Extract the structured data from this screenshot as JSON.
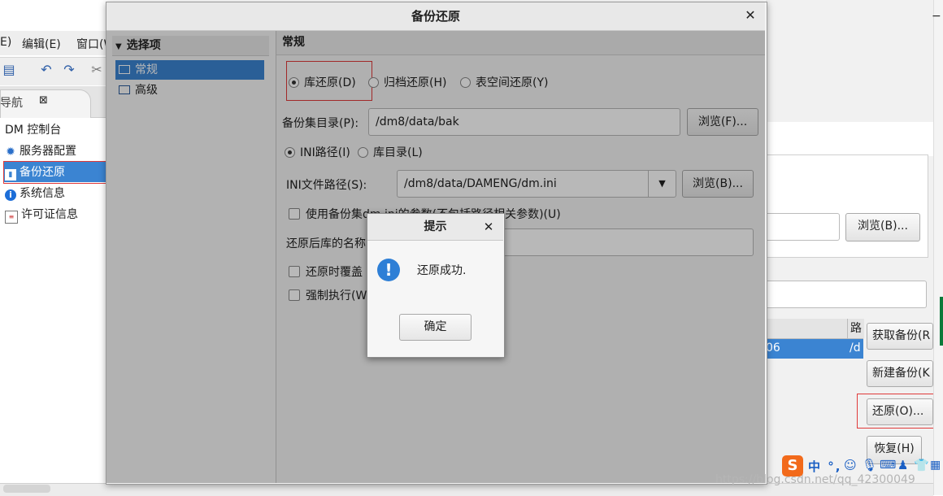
{
  "background": {
    "menu": [
      "E)",
      "编辑(E)",
      "窗口(W)"
    ],
    "tab_label": "导航",
    "nav_items": [
      {
        "label": "DM 控制台",
        "icon": ""
      },
      {
        "label": "服务器配置",
        "icon": "gear-icon"
      },
      {
        "label": "备份还原",
        "icon": "backup-icon"
      },
      {
        "label": "系统信息",
        "icon": "info-icon"
      },
      {
        "label": "许可证信息",
        "icon": "license-icon"
      }
    ],
    "right_browse_label": "浏览(B)...",
    "right_table_header": "路",
    "right_table_row_value": "06",
    "right_table_row_value2": "/d",
    "right_buttons": {
      "get_backup": "获取备份(R",
      "new_backup": "新建备份(K",
      "restore": "还原(O)...",
      "recover": "恢复(H)"
    }
  },
  "dialog": {
    "title": "备份还原",
    "options_header": "选择项",
    "options": [
      "常规",
      "高级"
    ],
    "section_title": "常规",
    "restore_types": [
      "库还原(D)",
      "归档还原(H)",
      "表空间还原(Y)"
    ],
    "backup_dir_label": "备份集目录(P):",
    "backup_dir_value": "/dm8/data/bak",
    "browse_f": "浏览(F)...",
    "ini_mode_options": [
      "INI路径(I)",
      "库目录(L)"
    ],
    "ini_path_label": "INI文件路径(S):",
    "ini_path_value": "/dm8/data/DAMENG/dm.ini",
    "browse_b": "浏览(B)...",
    "use_ini_params": "使用备份集dm.ini的参数(不包括路径相关参数)(U)",
    "db_name_label": "还原后库的名称",
    "overwrite_label": "还原时覆盖",
    "force_label": "强制执行(W"
  },
  "message": {
    "title": "提示",
    "text": "还原成功.",
    "ok": "确定"
  },
  "ime": {
    "logo": "S",
    "text": "中 °,"
  },
  "watermark": "https://blog.csdn.net/qq_42300049"
}
